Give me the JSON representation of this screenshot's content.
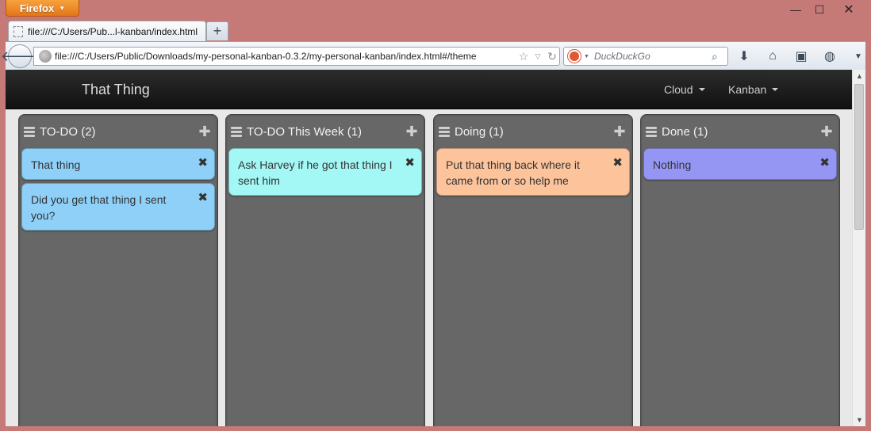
{
  "browser": {
    "menu_label": "Firefox",
    "tab_title": "file:///C:/Users/Pub...l-kanban/index.html",
    "url": "file:///C:/Users/Public/Downloads/my-personal-kanban-0.3.2/my-personal-kanban/index.html#/theme",
    "search_placeholder": "DuckDuckGo",
    "controls": {
      "minimize": "—",
      "maximize": "☐",
      "close": "✕"
    }
  },
  "app": {
    "brand": "That Thing",
    "menus": [
      {
        "label": "Cloud"
      },
      {
        "label": "Kanban"
      }
    ]
  },
  "columns": [
    {
      "title": "TO-DO (2)",
      "cards": [
        {
          "text": "That thing",
          "color": "#8ed0f8"
        },
        {
          "text": "Did you get that thing I sent you?",
          "color": "#8ed0f8"
        }
      ]
    },
    {
      "title": "TO-DO This Week (1)",
      "cards": [
        {
          "text": "Ask Harvey if he got that thing I sent him",
          "color": "#a3f7f5"
        }
      ]
    },
    {
      "title": "Doing (1)",
      "cards": [
        {
          "text": "Put that thing back where it came from or so help me",
          "color": "#fdc49c"
        }
      ]
    },
    {
      "title": "Done (1)",
      "cards": [
        {
          "text": "Nothing",
          "color": "#9596f4"
        }
      ]
    }
  ]
}
